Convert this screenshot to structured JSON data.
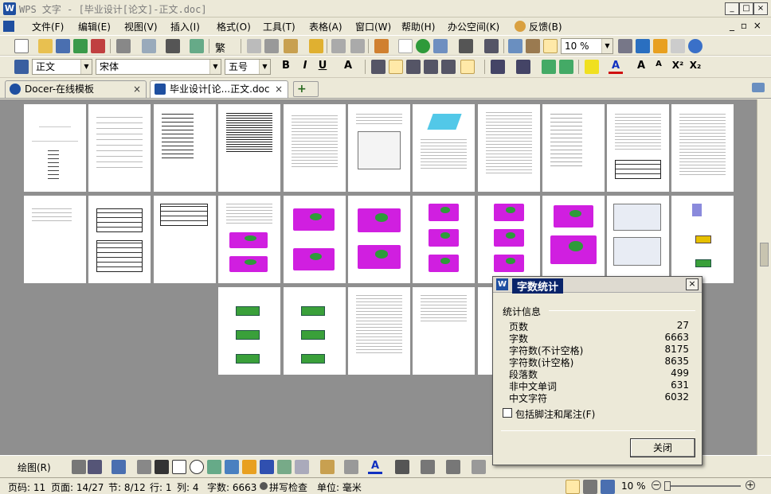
{
  "window": {
    "title": "WPS 文字 - [毕业设计[论文]-正文.doc]",
    "brand": "#1f4fa0",
    "buttons": {
      "minimize": "_",
      "maximize": "□",
      "close": "×"
    }
  },
  "menu": {
    "items": [
      "文件(F)",
      "编辑(E)",
      "视图(V)",
      "插入(I)",
      "格式(O)",
      "工具(T)",
      "表格(A)",
      "窗口(W)",
      "帮助(H)",
      "办公空间(K)",
      "反馈(B)"
    ],
    "restore": "_ ▫ ×"
  },
  "standard_toolbar": {
    "zoom": "10 %",
    "traditional": "繁"
  },
  "format_toolbar": {
    "style": "正文",
    "font": "宋体",
    "size": "五号",
    "bold": "B",
    "italic": "I",
    "underline": "U",
    "fontcolor": "A",
    "grow": "A",
    "shrink": "A",
    "superscript": "X²",
    "subscript": "X₂"
  },
  "tabs": [
    {
      "label": "Docer-在线模板",
      "close": "×"
    },
    {
      "label": "毕业设计[论...正文.doc",
      "close": "×"
    }
  ],
  "tab_add": "+",
  "drawbar": {
    "label": "绘图(R)"
  },
  "status": {
    "page": "页码: 11",
    "pages": "页面: 14/27",
    "section": "节: 8/12",
    "line": "行: 1",
    "col": "列: 4",
    "words": "字数: 6663",
    "spell": "拼写检查",
    "unit": "单位: 毫米",
    "zoom": "10 %"
  },
  "dialog": {
    "title": "字数统计",
    "group": "统计信息",
    "rows": [
      {
        "label": "页数",
        "value": "27"
      },
      {
        "label": "字数",
        "value": "6663"
      },
      {
        "label": "字符数(不计空格)",
        "value": "8175"
      },
      {
        "label": "字符数(计空格)",
        "value": "8635"
      },
      {
        "label": "段落数",
        "value": "499"
      },
      {
        "label": "非中文单词",
        "value": "631"
      },
      {
        "label": "中文字符",
        "value": "6032"
      }
    ],
    "checkbox": "包括脚注和尾注(F)",
    "button": "关闭",
    "close": "×"
  }
}
